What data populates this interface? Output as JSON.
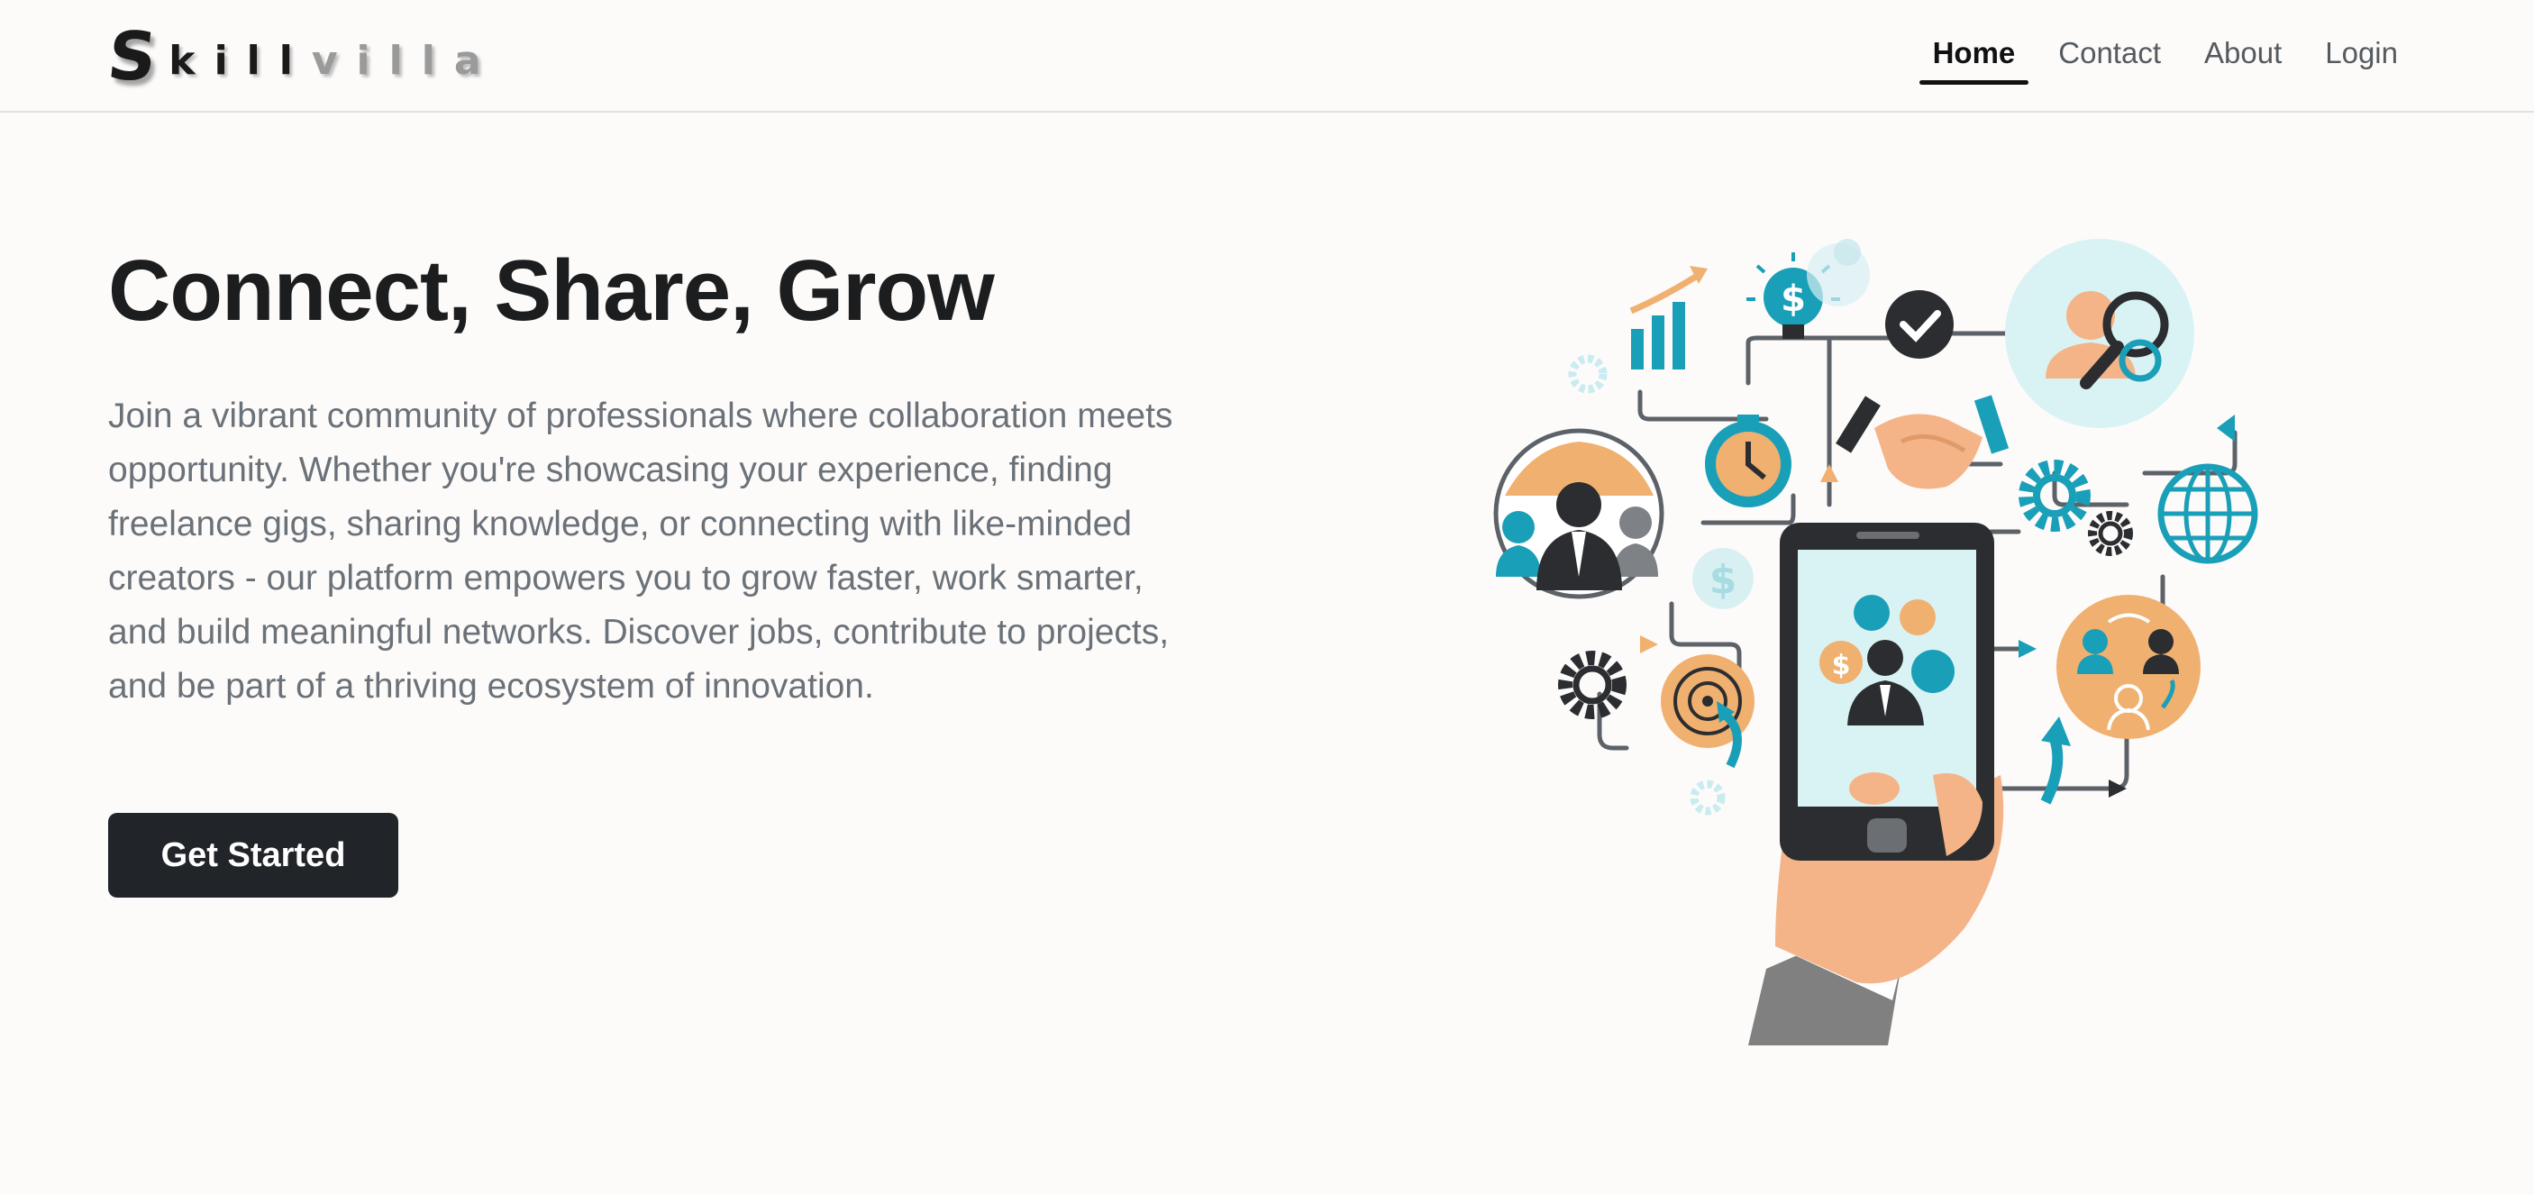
{
  "brand": {
    "initial": "S",
    "letters": [
      "k",
      "i",
      "l",
      "l",
      "v",
      "i",
      "l",
      "l",
      "a"
    ],
    "dark_color": "#1a1a1a",
    "light_color": "#9a9a9a"
  },
  "nav": {
    "items": [
      {
        "label": "Home",
        "active": true
      },
      {
        "label": "Contact",
        "active": false
      },
      {
        "label": "About",
        "active": false
      },
      {
        "label": "Login",
        "active": false
      }
    ]
  },
  "hero": {
    "title": "Connect, Share, Grow",
    "description": "Join a vibrant community of professionals where collaboration meets opportunity. Whether you're showcasing your experience, finding freelance gigs, sharing knowledge, or connecting with like-minded creators - our platform empowers you to grow faster, work smarter, and build meaningful networks. Discover jobs, contribute to projects, and be part of a thriving ecosystem of innovation.",
    "cta_label": "Get Started"
  },
  "illustration": {
    "accent_teal": "#1a9fb8",
    "accent_orange": "#f0b06f",
    "skin": "#f4b488",
    "dark": "#2b2d30",
    "icons": [
      "networking-hand-phone-illustration",
      "bar-chart-icon",
      "lightbulb-dollar-icon",
      "checkmark-icon",
      "search-person-icon",
      "globe-people-icon",
      "stopwatch-icon",
      "handshake-icon",
      "gear-icon",
      "world-globe-icon",
      "dollar-coin-icon",
      "target-icon",
      "team-exchange-icon"
    ]
  },
  "colors": {
    "background": "#fcfbfa",
    "text_primary": "#1c1d1f",
    "text_secondary": "#6b7178",
    "button_bg": "#212428"
  }
}
